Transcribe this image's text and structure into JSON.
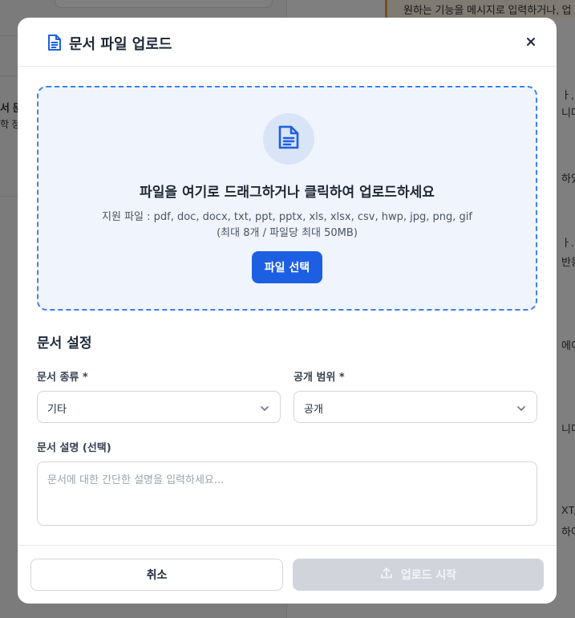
{
  "background": {
    "snippets": [
      "원하는 기능을 메시지로 입력하거나, 업",
      "서 문",
      "학 정",
      "ㅏ, 에",
      "니다",
      "하였",
      "ㅏ. 닉",
      "반응",
      "에이",
      "니다.",
      "XT,",
      "하여"
    ]
  },
  "modal": {
    "title": "문서 파일 업로드",
    "icons": {
      "title": "document-icon",
      "close": "close-icon"
    }
  },
  "dropzone": {
    "title": "파일을 여기로 드래그하거나 클릭하여 업로드하세요",
    "formats": "지원 파일 : pdf, doc, docx, txt, ppt, pptx, xls, xlsx, csv, hwp, jpg, png, gif",
    "limits": "(최대 8개 / 파일당 최대 50MB)",
    "button_label": "파일 선택",
    "icon": "document-icon"
  },
  "settings": {
    "section_title": "문서 설정",
    "doc_type": {
      "label": "문서 종류 *",
      "value": "기타"
    },
    "visibility": {
      "label": "공개 범위 *",
      "value": "공개"
    },
    "description": {
      "label": "문서 설명 (선택)",
      "placeholder": "문서에 대한 간단한 설명을 입력하세요..."
    }
  },
  "footer": {
    "cancel_label": "취소",
    "upload_label": "업로드 시작",
    "upload_enabled": false
  },
  "colors": {
    "primary": "#1d5fe3",
    "dropzone_border": "#3b82f6",
    "dropzone_bg": "#eff4fd",
    "disabled": "#d1d5db"
  }
}
